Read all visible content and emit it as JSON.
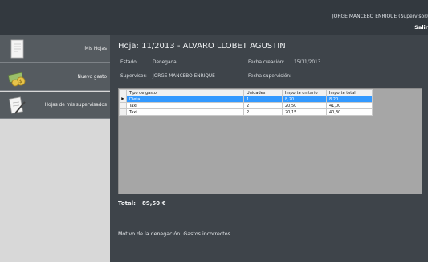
{
  "header": {
    "user": "JORGE MANCEBO ENRIQUE (Supervisor)",
    "logout": "Salir"
  },
  "sidebar": {
    "items": [
      {
        "label": "Mis Hojas",
        "icon": "document-icon"
      },
      {
        "label": "Nuevo gasto",
        "icon": "money-icon"
      },
      {
        "label": "Hojas de mis supervisados",
        "icon": "checklist-pencil-icon"
      }
    ]
  },
  "sheet": {
    "title": "Hoja:  11/2013 - ALVARO LLOBET AGUSTIN",
    "estado_label": "Estado:",
    "estado_value": "Denegada",
    "fecha_creacion_label": "Fecha creación:",
    "fecha_creacion_value": "15/11/2013",
    "supervisor_label": "Supervisor:",
    "supervisor_value": "JORGE MANCEBO ENRIQUE",
    "fecha_supervision_label": "Fecha supervisión:",
    "fecha_supervision_value": "---"
  },
  "table": {
    "columns": [
      "Tipo de gasto",
      "Unidades",
      "Importe unitario",
      "Importe total"
    ],
    "rows": [
      [
        "Dieta",
        "1",
        "8,20",
        "8,20"
      ],
      [
        "Taxi",
        "2",
        "20,50",
        "41,00"
      ],
      [
        "Taxi",
        "2",
        "20,15",
        "40,30"
      ]
    ],
    "selected_row": 0,
    "row_indicator": "▶"
  },
  "summary": {
    "total_label": "Total:",
    "total_value": "89,50 €",
    "reason": "Motivo de la denegación: Gastos incorrectos."
  },
  "colors": {
    "topbar": "#33393f",
    "sidebar_item": "#555b60",
    "main_bg": "#3e444a",
    "selection": "#3399ff"
  }
}
